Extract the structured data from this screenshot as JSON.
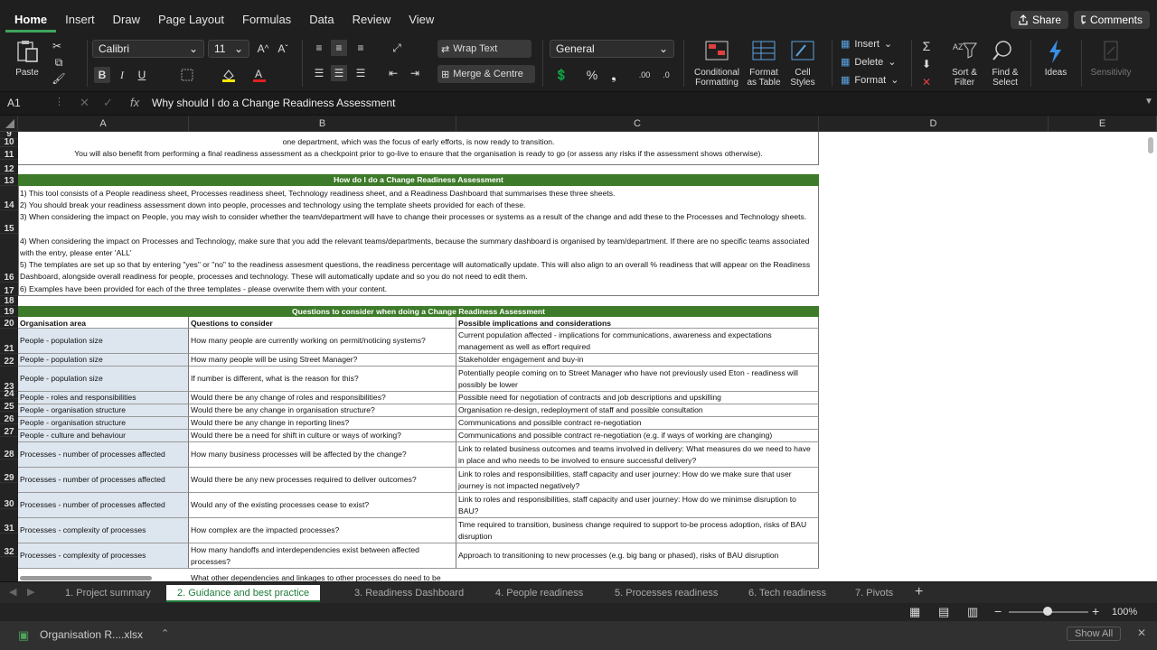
{
  "ribbon_tabs": [
    "Home",
    "Insert",
    "Draw",
    "Page Layout",
    "Formulas",
    "Data",
    "Review",
    "View"
  ],
  "share_label": "Share",
  "comments_label": "Comments",
  "clipboard": {
    "paste_label": "Paste"
  },
  "font": {
    "name": "Calibri",
    "size": "11"
  },
  "wrap_text_label": "Wrap Text",
  "merge_label": "Merge & Centre",
  "number_format": "General",
  "styles": {
    "conditional": "Conditional\nFormatting",
    "format_table": "Format\nas Table",
    "cell_styles": "Cell\nStyles"
  },
  "cells_group": {
    "insert": "Insert",
    "delete": "Delete",
    "format": "Format"
  },
  "editing": {
    "sort": "Sort &\nFilter",
    "find": "Find &\nSelect"
  },
  "ideas_label": "Ideas",
  "sensitivity_label": "Sensitivity",
  "formula_bar": {
    "name_box": "A1",
    "fx": "fx",
    "content": "Why should I do a Change Readiness Assessment"
  },
  "columns": [
    "A",
    "B",
    "C",
    "D",
    "E"
  ],
  "row_numbers": [
    "9",
    "10",
    "11",
    "12",
    "13",
    "14",
    "15",
    "16",
    "17",
    "18",
    "19",
    "20",
    "21",
    "22",
    "23",
    "24",
    "25",
    "26",
    "27",
    "28",
    "29",
    "30",
    "31",
    "32"
  ],
  "intro": {
    "line1": "one department, which was the focus of early efforts, is now ready to transition.",
    "line2": "You will also benefit from performing a final readiness assessment as a checkpoint prior to go-live to ensure that the organisation is ready to go (or assess any risks if the assessment shows otherwise)."
  },
  "how_header": "How do I do a Change Readiness Assessment",
  "how_lines": [
    "1) This tool consists of a People readiness sheet, Processes readiness sheet, Technology readiness sheet, and a Readiness Dashboard that summarises these three sheets.",
    "2) You should break your readiness assessment down into people, processes and technology using the template sheets provided for each of these.",
    "3) When considering the impact on People, you may wish to consider whether the team/department will have to change their processes or systems as a result of the change and add these to the Processes and Technology sheets.",
    "4) When considering the impact on Processes and Technology, make sure that you add the relevant teams/departments, because the summary dashboard is organised by team/department. If there are no specific teams associated with the entry, please enter 'ALL'",
    "5) The templates are set up so that by entering \"yes\" or \"no\" to the readiness assesment questions, the readiness percentage will automatically update. This will also align to an overall % readiness that will appear on the Readiness Dashboard, alongside overall readiness for people, processes and technology. These will automatically update and so you do not need to edit them.",
    "6) Examples have been provided for each of the three templates - please overwrite them with your content."
  ],
  "questions_header": "Questions to consider when doing a Change Readiness Assessment",
  "table_headers": [
    "Organisation area",
    "Questions to consider",
    "Possible implications and considerations"
  ],
  "table_rows": [
    [
      "People - population size",
      "How many people are currently working on permit/noticing systems?",
      "Current population affected - implications for communications, awareness and expectations management as well as effort required"
    ],
    [
      "People - population size",
      "How many people will be using Street Manager?",
      "Stakeholder engagement and buy-in"
    ],
    [
      "People - population size",
      "If number is different, what is the reason for this?",
      "Potentially people coming on to Street Manager who have not previously used Eton - readiness will possibly be lower"
    ],
    [
      "People - roles and responsibilities",
      "Would there be any change of roles and responsibilities?",
      "Possible need for negotiation of contracts and job descriptions and upskilling"
    ],
    [
      "People - organisation structure",
      "Would there be any change in organisation structure?",
      "Organisation re-design, redeployment of staff and possible consultation"
    ],
    [
      "People - organisation structure",
      "Would there be any change in reporting lines?",
      "Communications and possible contract re-negotiation"
    ],
    [
      "People - culture and behaviour",
      "Would there be a need for shift in culture or ways of working?",
      "Communications and possible contract re-negotiation (e.g. if ways of working are changing)"
    ],
    [
      "Processes - number of processes affected",
      "How many business processes will be affected by the change?",
      "Link to related business outcomes and teams involved in delivery: What measures do we need to have in place and who needs to be involved to ensure successful delivery?"
    ],
    [
      "Processes - number of processes affected",
      "Would there be any new processes required to deliver outcomes?",
      "Link to roles and responsibilities, staff capacity and user journey: How do we make sure that user journey is not impacted negatively?"
    ],
    [
      "Processes - number of processes affected",
      "Would any of the existing processes cease to exist?",
      "Link to roles and responsibilities, staff capacity and user journey: How do we minimse disruption to BAU?"
    ],
    [
      "Processes - complexity of processes",
      "How complex are the impacted processes?",
      "Time required to transition, business change required to support to-be process adoption, risks of BAU disruption"
    ],
    [
      "Processes - complexity of processes",
      "How many handoffs and interdependencies exist between affected processes?",
      "Approach to transitioning to new processes (e.g. big bang or phased), risks of BAU disruption"
    ]
  ],
  "partial_last_row": "What other dependencies and linkages to other processes do need to be",
  "sheet_tabs": [
    "1. Project summary",
    "2. Guidance and best practice",
    "3. Readiness Dashboard",
    "4. People readiness",
    "5. Processes readiness",
    "6. Tech readiness",
    "7. Pivots"
  ],
  "active_sheet_index": 1,
  "zoom": "100%",
  "dock": {
    "filename": "Organisation R....xlsx",
    "show_all": "Show All"
  },
  "colors": {
    "green_header": "#3d7a29",
    "active_tab": "#1f7a3a",
    "shade": "#dde6ef"
  }
}
